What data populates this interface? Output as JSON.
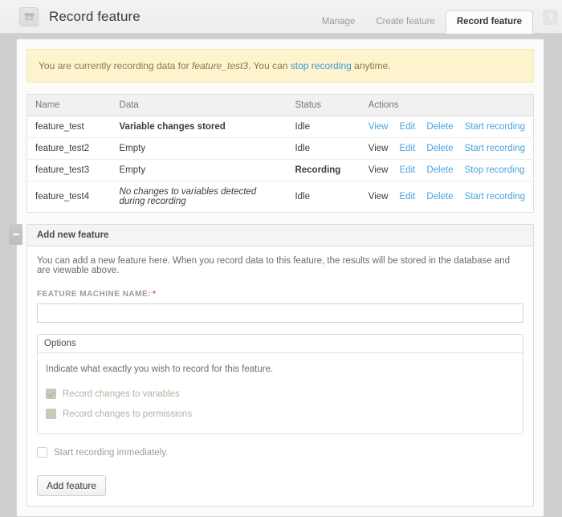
{
  "header": {
    "icon": "archive-box-icon",
    "title": "Record feature",
    "tabs": [
      {
        "label": "Manage",
        "active": false
      },
      {
        "label": "Create feature",
        "active": false
      },
      {
        "label": "Record feature",
        "active": true
      }
    ],
    "help_label": "?"
  },
  "banner": {
    "text_before": "You are currently recording data for ",
    "feature_name": "feature_test3",
    "text_middle": ". You can ",
    "link_label": "stop recording",
    "text_after": " anytime."
  },
  "table": {
    "columns": [
      "Name",
      "Data",
      "Status",
      "Actions"
    ],
    "rows": [
      {
        "name": "feature_test",
        "data": "Variable changes stored",
        "data_style": "bold",
        "status": "Idle",
        "status_style": "normal",
        "actions": [
          {
            "label": "View",
            "style": "link"
          },
          {
            "label": "Edit",
            "style": "link"
          },
          {
            "label": "Delete",
            "style": "link"
          },
          {
            "label": "Start recording",
            "style": "link"
          }
        ]
      },
      {
        "name": "feature_test2",
        "data": "Empty",
        "data_style": "normal",
        "status": "Idle",
        "status_style": "normal",
        "actions": [
          {
            "label": "View",
            "style": "dark"
          },
          {
            "label": "Edit",
            "style": "link"
          },
          {
            "label": "Delete",
            "style": "link"
          },
          {
            "label": "Start recording",
            "style": "link"
          }
        ]
      },
      {
        "name": "feature_test3",
        "data": "Empty",
        "data_style": "normal",
        "status": "Recording",
        "status_style": "bold",
        "actions": [
          {
            "label": "View",
            "style": "dark"
          },
          {
            "label": "Edit",
            "style": "link"
          },
          {
            "label": "Delete",
            "style": "link"
          },
          {
            "label": "Stop recording",
            "style": "link"
          }
        ]
      },
      {
        "name": "feature_test4",
        "data": "No changes to variables detected during recording",
        "data_style": "italic",
        "status": "Idle",
        "status_style": "normal",
        "actions": [
          {
            "label": "View",
            "style": "dark"
          },
          {
            "label": "Edit",
            "style": "link"
          },
          {
            "label": "Delete",
            "style": "link"
          },
          {
            "label": "Start recording",
            "style": "link"
          }
        ]
      }
    ]
  },
  "add_feature": {
    "collapse_symbol": "minus",
    "legend": "Add new feature",
    "description": "You can add a new feature here. When you record data to this feature, the results will be stored in the database and are viewable above.",
    "name_label": "FEATURE MACHINE NAME:",
    "required_marker": "*",
    "name_value": "",
    "name_placeholder": "",
    "options": {
      "legend": "Options",
      "description": "Indicate what exactly you wish to record for this feature.",
      "checkboxes": [
        {
          "label": "Record changes to variables",
          "checked": true,
          "disabled": true
        },
        {
          "label": "Record changes to permissions",
          "checked": false,
          "disabled": true
        }
      ]
    },
    "start_now": {
      "label": "Start recording immediately.",
      "checked": false
    },
    "submit_label": "Add feature"
  },
  "colors": {
    "link": "#4aa3df",
    "banner_bg": "#fdf3cd",
    "banner_border": "#f5e9b8",
    "required": "#ee4444",
    "page_bg": "#cfcfcf"
  }
}
